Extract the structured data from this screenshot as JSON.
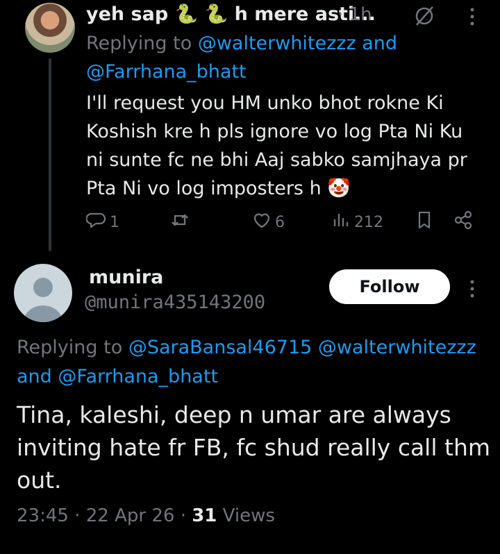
{
  "reply": {
    "display_name_part1": "yeh sap",
    "snake_emoji": "🐍",
    "display_name_part2": "h mere asti...",
    "separator": "·",
    "time": "1h",
    "replying_to_prefix": "Replying to",
    "replying_to_user1": "@walterwhitezzz",
    "replying_to_and": "and",
    "replying_to_user2": "@Farrhana_bhatt",
    "text": "I'll request you HM unko bhot rokne Ki Koshish kre h pls ignore vo log Pta Ni Ku ni sunte fc ne bhi Aaj sabko samjhaya pr Pta Ni vo log imposters h",
    "text_emoji": "🤡",
    "replies_count": "1",
    "likes_count": "6",
    "views_count": "212"
  },
  "main_tweet": {
    "display_name": "munira",
    "handle": "@munira435143200",
    "follow_label": "Follow",
    "replying_to_prefix": "Replying to",
    "replying_to_user1": "@SaraBansal46715",
    "replying_to_user2": "@walterwhitezzz",
    "replying_to_and": "and",
    "replying_to_user3": "@Farrhana_bhatt",
    "text": "Tina, kaleshi, deep n umar are always inviting hate fr FB, fc shud really call thm out.",
    "time": "23:45",
    "separator": "·",
    "date": "22 Apr 26",
    "views_count": "31",
    "views_label": "Views"
  },
  "colors": {
    "background": "#000000",
    "text": "#e7e9ea",
    "secondary": "#71767b",
    "link": "#1d9bf0"
  }
}
